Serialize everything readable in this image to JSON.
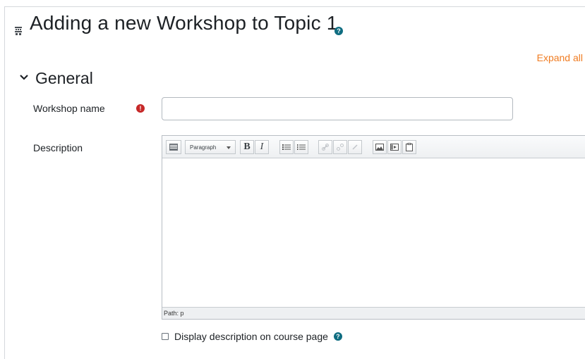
{
  "header": {
    "title": "Adding a new Workshop to Topic 1",
    "page_icon": "workshop-icon",
    "help_icon": "question-circle-icon"
  },
  "expand_all": "Expand all",
  "section": {
    "title": "General",
    "toggle_icon": "chevron-down-icon"
  },
  "form": {
    "workshop_name_label": "Workshop name",
    "workshop_name_value": "",
    "required_icon": "exclamation-circle-icon",
    "description_label": "Description",
    "editor": {
      "format_select": "Paragraph",
      "toolbar_buttons": [
        "toggle-toolbar",
        "bold",
        "italic",
        "unordered-list",
        "ordered-list",
        "link",
        "unlink",
        "anchor",
        "image",
        "media",
        "paste"
      ],
      "bold_glyph": "B",
      "italic_glyph": "I",
      "status_path": "Path: p",
      "content": ""
    },
    "display_description_label": "Display description on course page",
    "display_description_checked": false
  },
  "colors": {
    "accent_link": "#f07c22",
    "help_icon": "#0f6d81",
    "required_icon": "#c62828"
  }
}
